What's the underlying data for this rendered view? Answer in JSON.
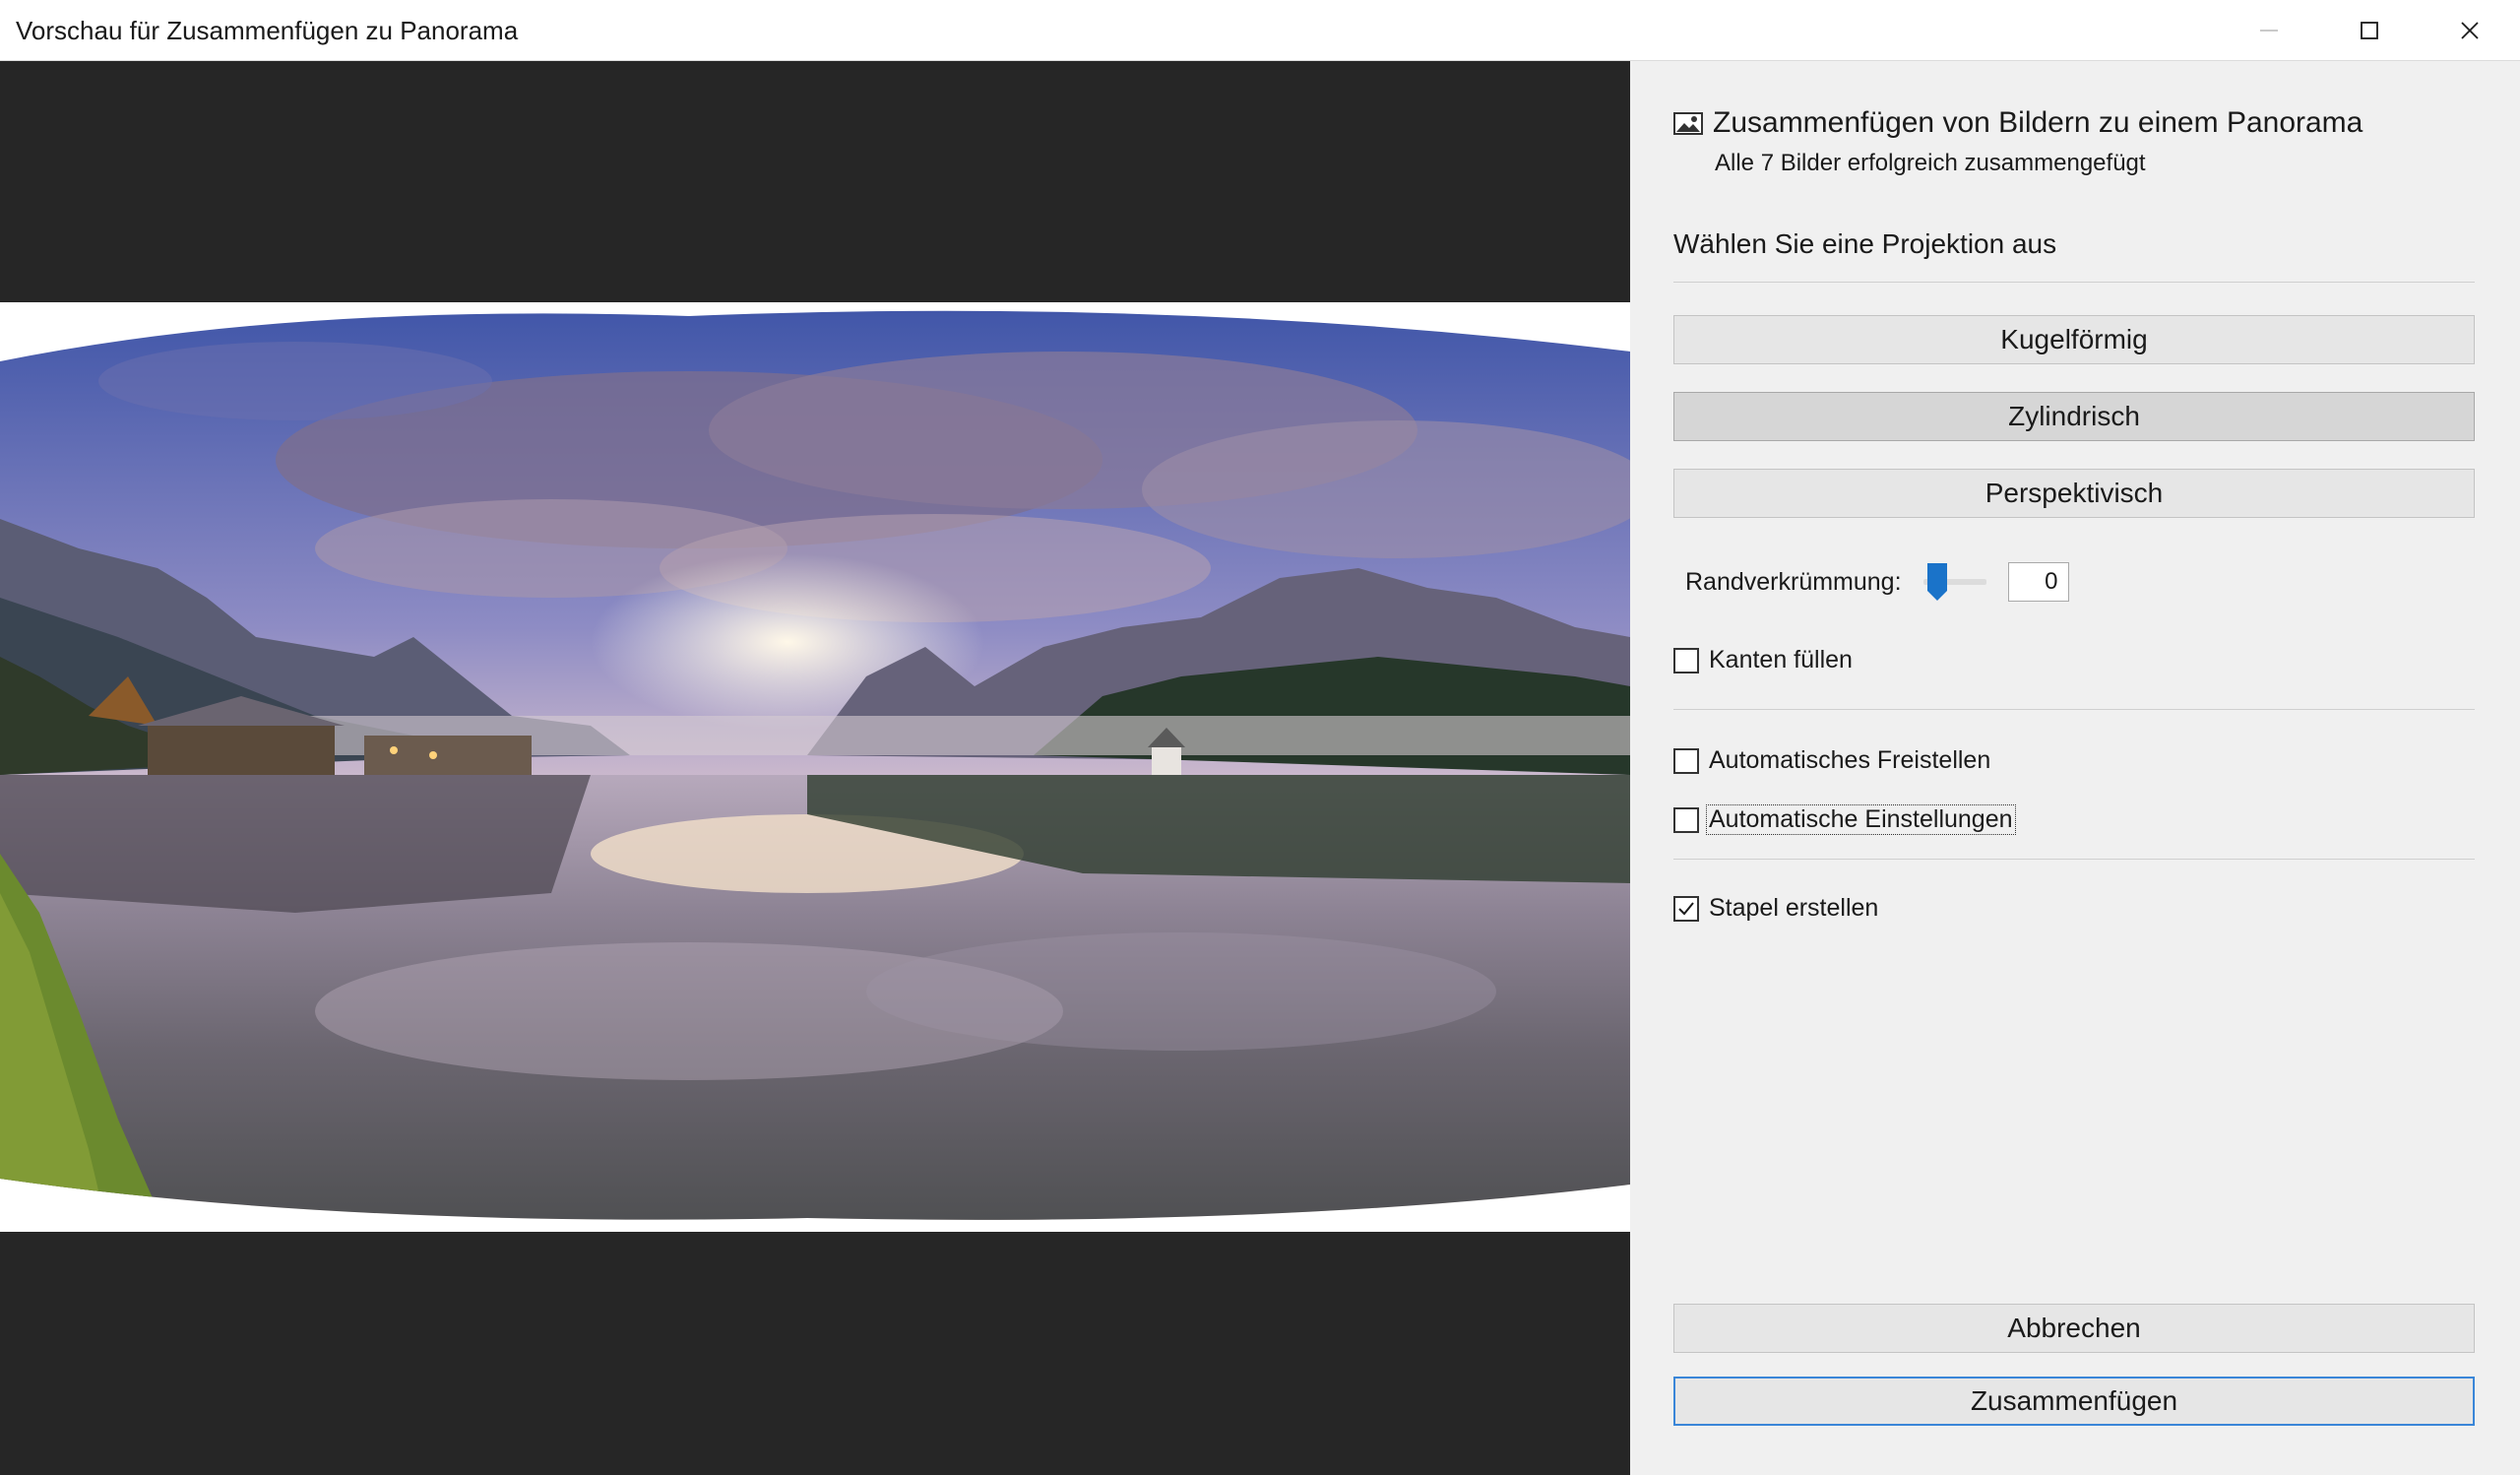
{
  "window": {
    "title": "Vorschau für Zusammenfügen zu Panorama",
    "controls": [
      "minimize-icon",
      "maximize-icon",
      "close-icon"
    ]
  },
  "panel": {
    "title": "Zusammenfügen von Bildern zu einem Panorama",
    "subtitle": "Alle 7 Bilder erfolgreich zusammengefügt",
    "projection_label": "Wählen Sie eine Projektion aus",
    "projections": [
      {
        "label": "Kugelförmig",
        "selected": false
      },
      {
        "label": "Zylindrisch",
        "selected": true
      },
      {
        "label": "Perspektivisch",
        "selected": false
      }
    ],
    "boundary_warp": {
      "label": "Randverkrümmung:",
      "value": "0"
    },
    "checkboxes": {
      "fill_edges": {
        "label": "Kanten füllen",
        "checked": false
      },
      "auto_crop": {
        "label": "Automatisches Freistellen",
        "checked": false
      },
      "auto_settings": {
        "label": "Automatische Einstellungen",
        "checked": false
      },
      "create_stack": {
        "label": "Stapel erstellen",
        "checked": true
      }
    },
    "cancel_label": "Abbrechen",
    "merge_label": "Zusammenfügen"
  },
  "colors": {
    "preview_background": "#262626",
    "panel_background": "#f0f0f0",
    "primary_border": "#3a86d8",
    "slider_thumb": "#1a73c9"
  }
}
